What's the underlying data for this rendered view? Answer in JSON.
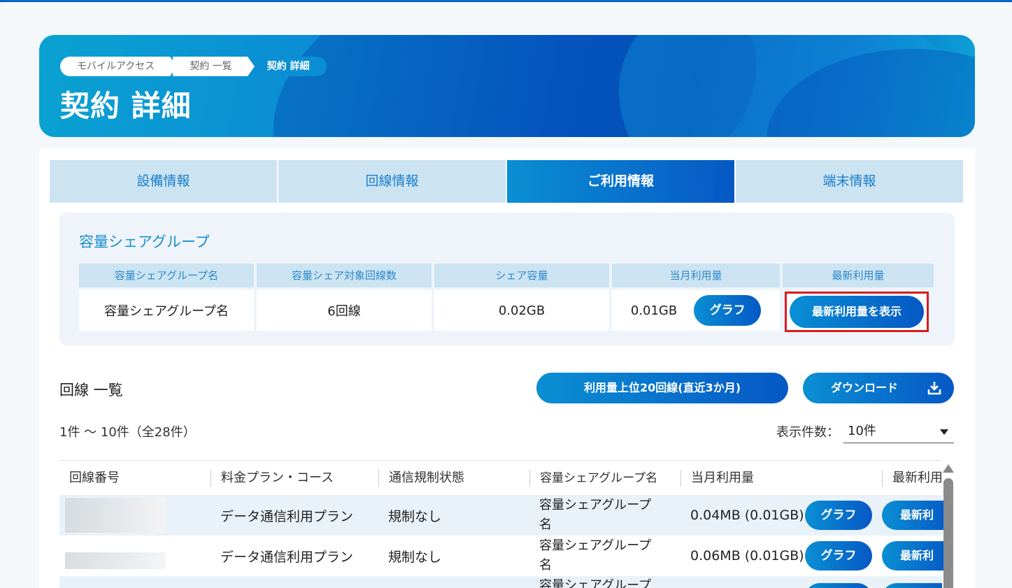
{
  "breadcrumb": [
    "モバイルアクセス",
    "契約 一覧",
    "契約 詳細"
  ],
  "page_title": "契約 詳細",
  "tabs": [
    {
      "label": "設備情報"
    },
    {
      "label": "回線情報"
    },
    {
      "label": "ご利用情報",
      "active": true
    },
    {
      "label": "端末情報"
    }
  ],
  "share_group": {
    "title": "容量シェアグループ",
    "headers": [
      "容量シェアグループ名",
      "容量シェア対象回線数",
      "シェア容量",
      "当月利用量",
      "最新利用量"
    ],
    "row": {
      "name": "容量シェアグループ名",
      "line_count": "6回線",
      "share_capacity": "0.02GB",
      "monthly_usage": "0.01GB",
      "graph_label": "グラフ",
      "latest_label": "最新利用量を表示"
    }
  },
  "lines": {
    "title": "回線 一覧",
    "top20_label": "利用量上位20回線(直近3か月)",
    "download_label": "ダウンロード",
    "count_text": "1件 〜 10件（全28件）",
    "per_page_label": "表示件数：",
    "per_page_value": "10件",
    "headers": [
      "回線番号",
      "料金プラン・コース",
      "通信規制状態",
      "容量シェアグループ名",
      "当月利用量",
      "最新利用"
    ],
    "rows": [
      {
        "plan": "データ通信利用プラン",
        "status": "規制なし",
        "group_line1": "容量シェアグループ",
        "group_line2": "名",
        "usage": "0.04MB (0.01GB)",
        "graph": "グラフ",
        "latest": "最新利"
      },
      {
        "plan": "データ通信利用プラン",
        "status": "規制なし",
        "group_line1": "容量シェアグループ",
        "group_line2": "名",
        "usage": "0.06MB (0.01GB)",
        "graph": "グラフ",
        "latest": "最新利"
      },
      {
        "plan": "",
        "status": "",
        "group_line1": "容量シェアグループ",
        "group_line2": "",
        "usage": "",
        "graph": "",
        "latest": ""
      }
    ]
  },
  "colors": {
    "accent": "#0a8fd3",
    "accent_dark": "#0658c5",
    "highlight": "#d71d1d",
    "tab_inactive": "#cce3f2"
  }
}
